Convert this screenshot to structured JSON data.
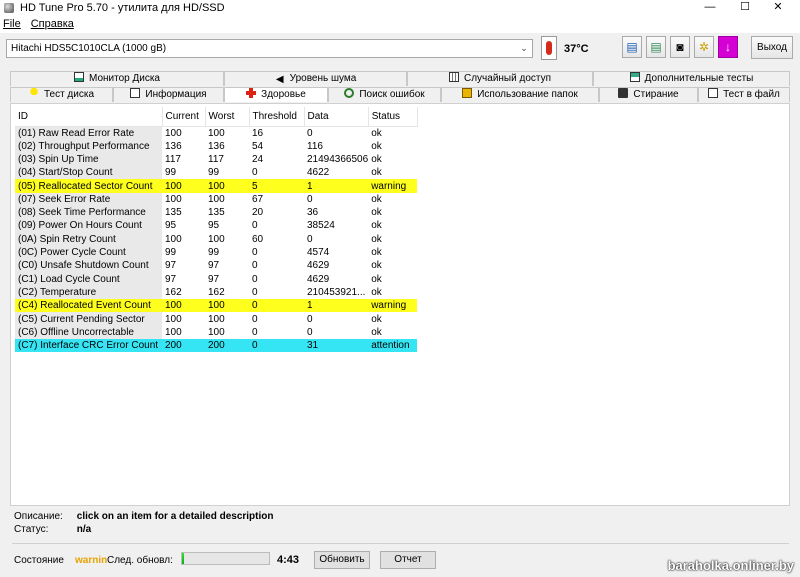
{
  "window": {
    "title": "HD Tune Pro 5.70 - утилита для HD/SSD",
    "min": "—",
    "max": "☐",
    "close": "✕"
  },
  "menu": {
    "file": "File",
    "help": "Справка"
  },
  "toolbar": {
    "drive": "Hitachi HDS5C1010CLA (1000 gB)",
    "temperature": "37°C",
    "exit_label": "Выход"
  },
  "tabs_row1": [
    {
      "label": "Монитор Диска",
      "icon": "chart-icon"
    },
    {
      "label": "Уровень шума",
      "icon": "speaker-icon"
    },
    {
      "label": "Случайный доступ",
      "icon": "random-access-icon"
    },
    {
      "label": "Дополнительные  тесты",
      "icon": "extra-tests-icon"
    }
  ],
  "tabs_row2": [
    {
      "label": "Тест диска",
      "icon": "bulb-icon"
    },
    {
      "label": "Информация",
      "icon": "info-icon"
    },
    {
      "label": "Здоровье",
      "icon": "health-cross-icon",
      "active": true
    },
    {
      "label": "Поиск ошибок",
      "icon": "magnifier-icon"
    },
    {
      "label": "Использование папок",
      "icon": "folder-icon"
    },
    {
      "label": "Стирание",
      "icon": "trash-icon"
    },
    {
      "label": "Тест в файл",
      "icon": "file-test-icon"
    }
  ],
  "table": {
    "headers": [
      "ID",
      "Current",
      "Worst",
      "Threshold",
      "Data",
      "Status"
    ],
    "rows": [
      {
        "id": "(01) Raw Read Error Rate",
        "current": "100",
        "worst": "100",
        "threshold": "16",
        "data": "0",
        "status": "ok",
        "level": "ok"
      },
      {
        "id": "(02) Throughput Performance",
        "current": "136",
        "worst": "136",
        "threshold": "54",
        "data": "116",
        "status": "ok",
        "level": "ok"
      },
      {
        "id": "(03) Spin Up Time",
        "current": "117",
        "worst": "117",
        "threshold": "24",
        "data": "21494366506",
        "status": "ok",
        "level": "ok"
      },
      {
        "id": "(04) Start/Stop Count",
        "current": "99",
        "worst": "99",
        "threshold": "0",
        "data": "4622",
        "status": "ok",
        "level": "ok"
      },
      {
        "id": "(05) Reallocated Sector Count",
        "current": "100",
        "worst": "100",
        "threshold": "5",
        "data": "1",
        "status": "warning",
        "level": "warning"
      },
      {
        "id": "(07) Seek Error Rate",
        "current": "100",
        "worst": "100",
        "threshold": "67",
        "data": "0",
        "status": "ok",
        "level": "ok"
      },
      {
        "id": "(08) Seek Time Performance",
        "current": "135",
        "worst": "135",
        "threshold": "20",
        "data": "36",
        "status": "ok",
        "level": "ok"
      },
      {
        "id": "(09) Power On Hours Count",
        "current": "95",
        "worst": "95",
        "threshold": "0",
        "data": "38524",
        "status": "ok",
        "level": "ok"
      },
      {
        "id": "(0A) Spin Retry Count",
        "current": "100",
        "worst": "100",
        "threshold": "60",
        "data": "0",
        "status": "ok",
        "level": "ok"
      },
      {
        "id": "(0C) Power Cycle Count",
        "current": "99",
        "worst": "99",
        "threshold": "0",
        "data": "4574",
        "status": "ok",
        "level": "ok"
      },
      {
        "id": "(C0) Unsafe Shutdown Count",
        "current": "97",
        "worst": "97",
        "threshold": "0",
        "data": "4629",
        "status": "ok",
        "level": "ok"
      },
      {
        "id": "(C1) Load Cycle Count",
        "current": "97",
        "worst": "97",
        "threshold": "0",
        "data": "4629",
        "status": "ok",
        "level": "ok"
      },
      {
        "id": "(C2) Temperature",
        "current": "162",
        "worst": "162",
        "threshold": "0",
        "data": "210453921...",
        "status": "ok",
        "level": "ok"
      },
      {
        "id": "(C4) Reallocated Event Count",
        "current": "100",
        "worst": "100",
        "threshold": "0",
        "data": "1",
        "status": "warning",
        "level": "warning"
      },
      {
        "id": "(C5) Current Pending Sector",
        "current": "100",
        "worst": "100",
        "threshold": "0",
        "data": "0",
        "status": "ok",
        "level": "ok"
      },
      {
        "id": "(C6) Offline Uncorrectable",
        "current": "100",
        "worst": "100",
        "threshold": "0",
        "data": "0",
        "status": "ok",
        "level": "ok"
      },
      {
        "id": "(C7) Interface CRC Error Count",
        "current": "200",
        "worst": "200",
        "threshold": "0",
        "data": "31",
        "status": "attention",
        "level": "attention"
      }
    ]
  },
  "description": {
    "label1": "Описание:",
    "value1": "click on an item for a detailed description",
    "label2": "Статус:",
    "value2": "n/a"
  },
  "statusbar": {
    "state_label": "Состояние",
    "state_value": "warnin",
    "next_update_label": "След. обновл:",
    "progress_fraction": 0.02,
    "time": "4:43",
    "refresh_label": "Обновить",
    "report_label": "Отчет"
  },
  "watermark": "baraholka.onliner.by",
  "colors": {
    "warning_row": "#ffff1e",
    "attention_row": "#36e5f4",
    "progress": "#06b025",
    "state_warning": "#e7a300"
  }
}
